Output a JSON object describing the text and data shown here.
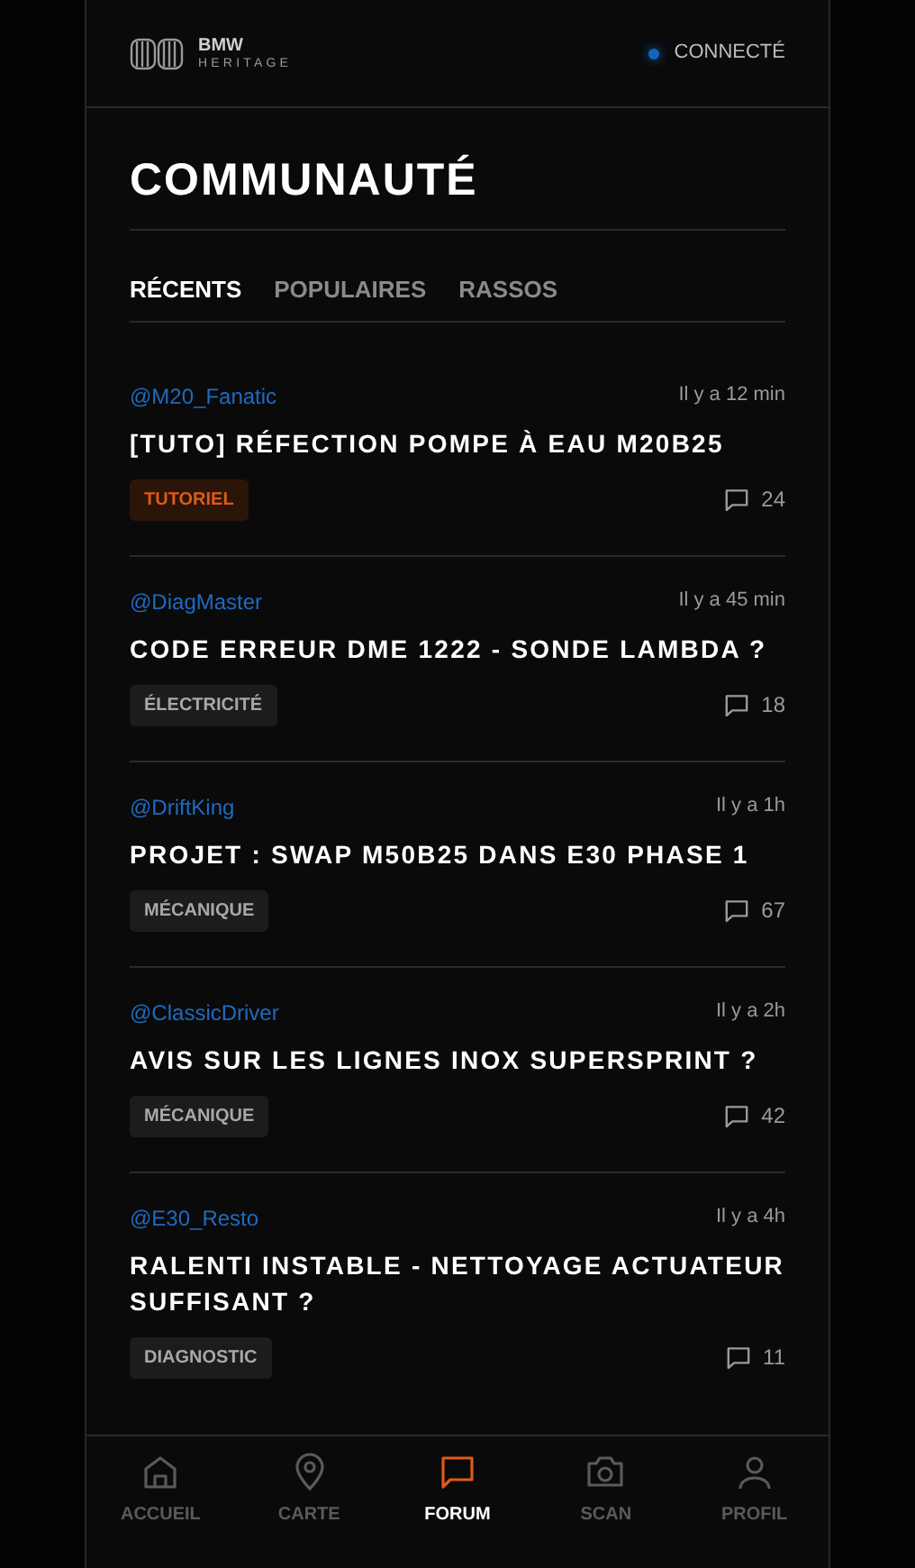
{
  "header": {
    "logo_top": "BMW",
    "logo_bottom": "HERITAGE",
    "status": "CONNECTÉ"
  },
  "title": "COMMUNAUTÉ",
  "tabs": [
    {
      "label": "RÉCENTS",
      "selected": true
    },
    {
      "label": "POPULAIRES",
      "selected": false
    },
    {
      "label": "RASSOS",
      "selected": false
    }
  ],
  "posts": [
    {
      "author": "@M20_Fanatic",
      "time": "Il y a 12 min",
      "title": "[TUTO] RÉFECTION POMPE À EAU M20B25",
      "tag": "TUTORIEL",
      "tag_highlighted": true,
      "comments": "24"
    },
    {
      "author": "@DiagMaster",
      "time": "Il y a 45 min",
      "title": "CODE ERREUR DME 1222 - SONDE LAMBDA ?",
      "tag": "ÉLECTRICITÉ",
      "tag_highlighted": false,
      "comments": "18"
    },
    {
      "author": "@DriftKing",
      "time": "Il y a 1h",
      "title": "PROJET : SWAP M50B25 DANS E30 PHASE 1",
      "tag": "MÉCANIQUE",
      "tag_highlighted": false,
      "comments": "67"
    },
    {
      "author": "@ClassicDriver",
      "time": "Il y a 2h",
      "title": "AVIS SUR LES LIGNES INOX SUPERSPRINT ?",
      "tag": "MÉCANIQUE",
      "tag_highlighted": false,
      "comments": "42"
    },
    {
      "author": "@E30_Resto",
      "time": "Il y a 4h",
      "title": "RALENTI INSTABLE - NETTOYAGE ACTUATEUR SUFFISANT ?",
      "tag": "DIAGNOSTIC",
      "tag_highlighted": false,
      "comments": "11"
    }
  ],
  "nav": [
    {
      "kind": "home",
      "label": "ACCUEIL",
      "selected": false
    },
    {
      "kind": "map",
      "label": "CARTE",
      "selected": false
    },
    {
      "kind": "forum",
      "label": "FORUM",
      "selected": true
    },
    {
      "kind": "camera",
      "label": "SCAN",
      "selected": false
    },
    {
      "kind": "profile",
      "label": "PROFIL",
      "selected": false
    }
  ]
}
